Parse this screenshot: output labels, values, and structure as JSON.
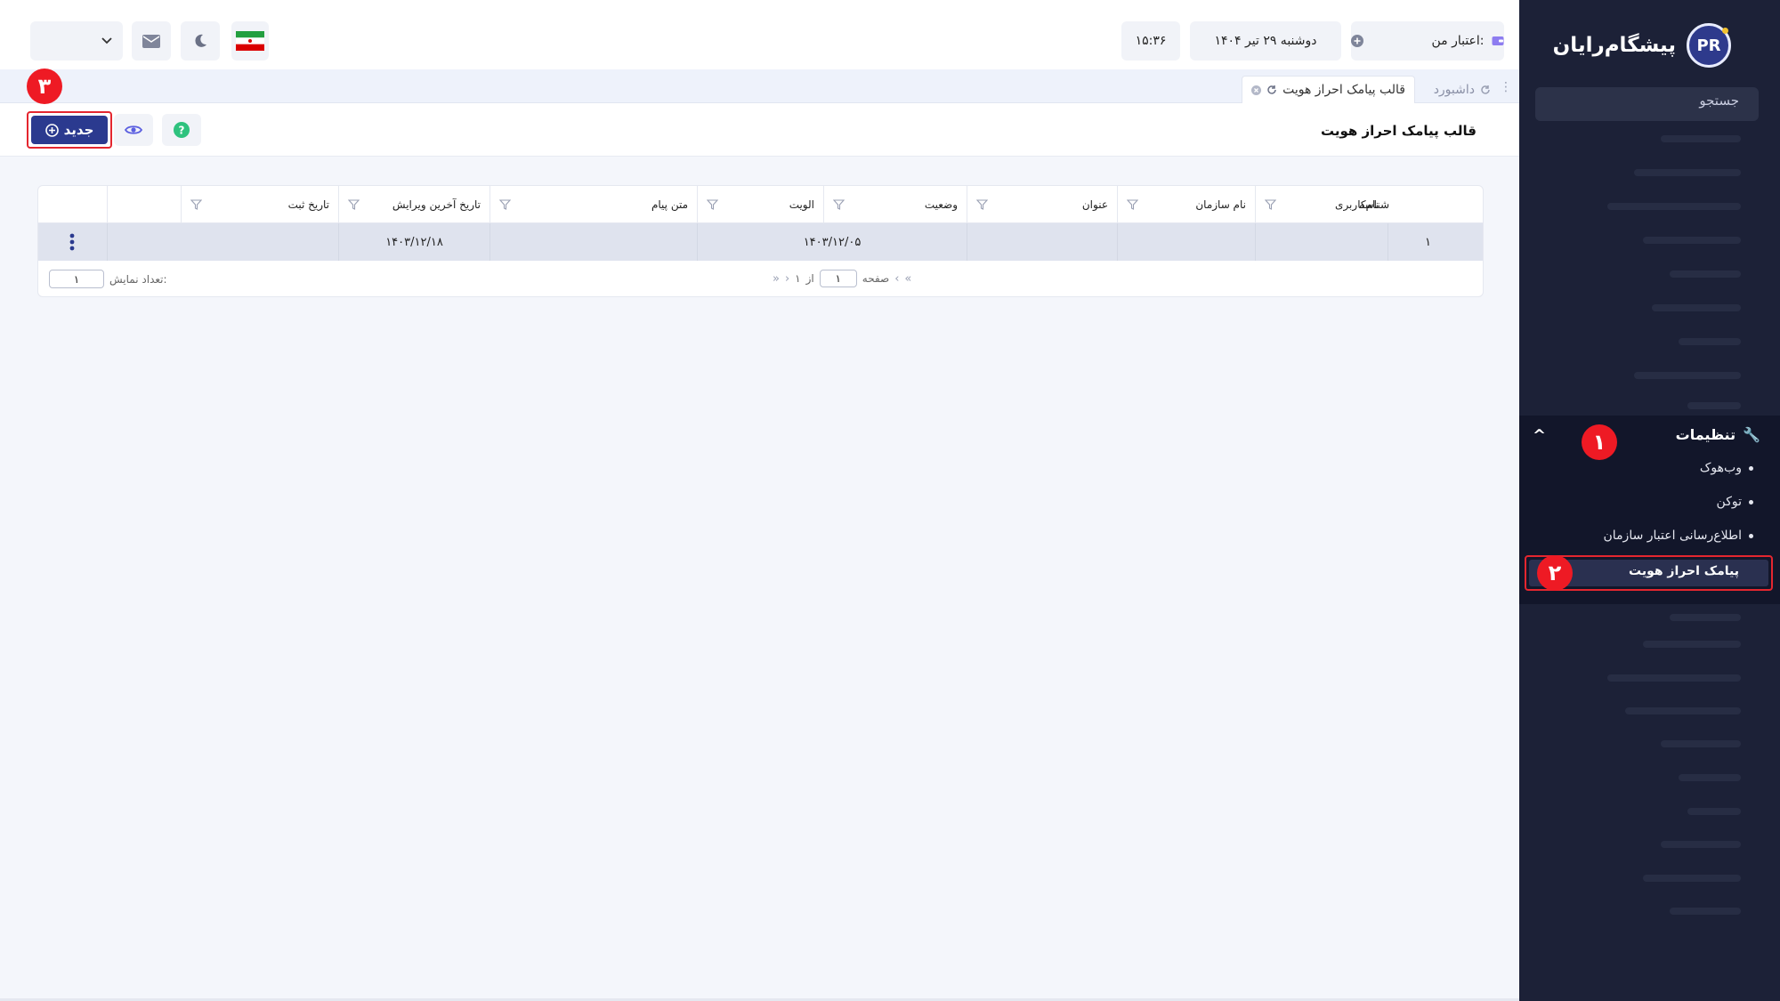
{
  "sidebar": {
    "logo_text": "پیشگام‌رایان",
    "logo_mark": "PR",
    "search_label": "جستجو",
    "settings_label": "تنظیمات",
    "sub_items": [
      {
        "label": "وب‌هوک"
      },
      {
        "label": "توکن"
      },
      {
        "label": "اطلاع‌رسانی اعتبار سازمان"
      }
    ],
    "active_item": "پیامک احراز هویت",
    "step_badges": [
      "۱",
      "۲"
    ]
  },
  "topbar": {
    "credit_label": "اعتبار من:",
    "date": "دوشنبه ۲۹ تیر ۱۴۰۴",
    "time": "۱۵:۳۶"
  },
  "tabs": [
    {
      "label": "داشبورد"
    },
    {
      "label": "قالب پیامک احراز هویت"
    }
  ],
  "page": {
    "title": "قالب پیامک احراز هویت",
    "new_button": "جدید",
    "step_badge": "۳"
  },
  "table": {
    "columns": [
      "شناسه",
      "نام‌کاربری",
      "نام سازمان",
      "عنوان",
      "وضعیت",
      "الویت",
      "متن پیام",
      "تاریخ آخرین ویرایش",
      "تاریخ ثبت"
    ],
    "row": {
      "id": "۱",
      "status_date": "۱۴۰۳/۱۲/۰۵",
      "last_edit": "۱۴۰۳/۱۲/۱۸"
    },
    "pager": {
      "page_label": "صفحه",
      "page_value": "۱",
      "of_label": "از",
      "total": "۱"
    },
    "count_label": "تعداد نمایش:",
    "count_value": "۱"
  },
  "colors": {
    "sidebar_bg": "#1c2137",
    "accent": "#2b3a8f",
    "highlight": "#e4262f",
    "badge": "#ee1a24"
  }
}
